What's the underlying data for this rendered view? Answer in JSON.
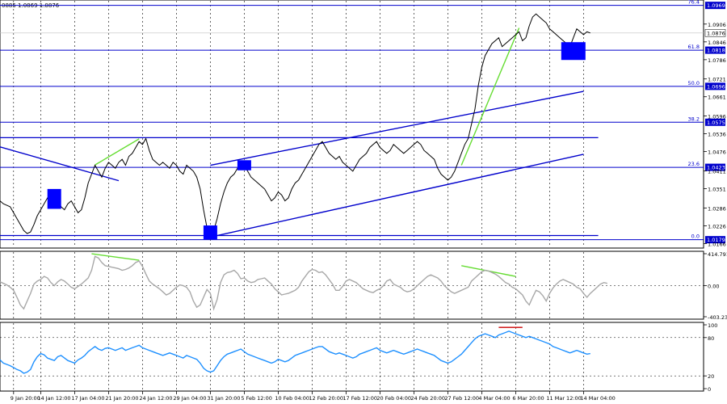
{
  "header": {
    "ohlc_text": "0885 1.0869 1.0876"
  },
  "chart_data": [
    {
      "type": "line",
      "panel": "price",
      "symbol": "EURUSD",
      "timeframe": "H4",
      "ylim": [
        1.0159,
        1.0979
      ],
      "y_axis_labels": [
        {
          "text": "1.0906",
          "y": 1.0906
        },
        {
          "text": "1.0846",
          "y": 1.0846
        },
        {
          "text": "1.0786",
          "y": 1.0786
        },
        {
          "text": "1.0721",
          "y": 1.0721
        },
        {
          "text": "1.0661",
          "y": 1.0661
        },
        {
          "text": "1.0596",
          "y": 1.0596
        },
        {
          "text": "1.0536",
          "y": 1.0536
        },
        {
          "text": "1.0476",
          "y": 1.0476
        },
        {
          "text": "1.0411",
          "y": 1.0411
        },
        {
          "text": "1.0351",
          "y": 1.0351
        },
        {
          "text": "1.0286",
          "y": 1.0286
        },
        {
          "text": "1.0226",
          "y": 1.0226
        },
        {
          "text": "1.0166",
          "y": 1.0166
        }
      ],
      "current_price": {
        "text": "1.0876",
        "y": 1.0876
      },
      "fibonacci_levels": [
        {
          "label": "76.4",
          "value_text": "1.0969",
          "y": 1.0969
        },
        {
          "label": "61.8",
          "value_text": "1.0818",
          "y": 1.0818
        },
        {
          "label": "50.0",
          "value_text": "1.0696",
          "y": 1.0696
        },
        {
          "label": "38.2",
          "value_text": "1.0575",
          "y": 1.0575
        },
        {
          "label": "23.6",
          "value_text": "1.0423",
          "y": 1.0423
        },
        {
          "label": "0.0",
          "value_text": "1.0179",
          "y": 1.0179
        }
      ],
      "horizontal_lines": [
        {
          "y": 1.0523,
          "x_from": 0,
          "x_to": 153
        },
        {
          "y": 1.0193,
          "x_from": 0,
          "x_to": 153
        }
      ],
      "trend_lines": [
        {
          "color": "#0000cc",
          "points": [
            [
              0,
              1.0492
            ],
            [
              35,
              1.0378
            ]
          ]
        },
        {
          "color": "#0000cc",
          "points": [
            [
              64,
              1.0193
            ],
            [
              172,
              1.0467
            ]
          ]
        },
        {
          "color": "#0000cc",
          "points": [
            [
              62,
              1.043
            ],
            [
              172,
              1.0679
            ]
          ]
        },
        {
          "color": "#66dd33",
          "points": [
            [
              28,
              1.0431
            ],
            [
              41,
              1.0519
            ]
          ]
        },
        {
          "color": "#66dd33",
          "points": [
            [
              136,
              1.043
            ],
            [
              153,
              1.0893
            ]
          ]
        }
      ],
      "markers": [
        {
          "x": 16,
          "y_top": 1.035,
          "y_bottom": 1.0283
        },
        {
          "x": 62,
          "y_top": 1.0227,
          "y_bottom": 1.018
        },
        {
          "x": 72,
          "y_top": 1.0447,
          "y_bottom": 1.0413
        },
        {
          "x": 169,
          "y_top": 1.0845,
          "y_bottom": 1.0785
        }
      ],
      "vertical_grid_x": [
        4,
        12,
        22,
        32,
        42,
        52,
        62,
        72,
        82,
        92,
        102,
        112,
        122,
        132,
        142,
        152,
        162,
        172
      ],
      "series": [
        {
          "values": [
            1.031,
            1.03,
            1.0295,
            1.029,
            1.027,
            1.025,
            1.023,
            1.021,
            1.02,
            1.0205,
            1.023,
            1.026,
            1.028,
            1.03,
            1.032,
            1.031,
            1.03,
            1.032,
            1.029,
            1.028,
            1.03,
            1.031,
            1.029,
            1.027,
            1.028,
            1.032,
            1.037,
            1.04,
            1.043,
            1.041,
            1.039,
            1.042,
            1.044,
            1.043,
            1.042,
            1.044,
            1.045,
            1.043,
            1.046,
            1.047,
            1.049,
            1.051,
            1.05,
            1.052,
            1.048,
            1.045,
            1.044,
            1.043,
            1.044,
            1.043,
            1.042,
            1.044,
            1.043,
            1.041,
            1.04,
            1.043,
            1.042,
            1.041,
            1.039,
            1.035,
            1.028,
            1.022,
            1.02,
            1.021,
            1.025,
            1.03,
            1.034,
            1.037,
            1.039,
            1.04,
            1.042,
            1.044,
            1.043,
            1.041,
            1.039,
            1.038,
            1.037,
            1.036,
            1.035,
            1.033,
            1.031,
            1.032,
            1.034,
            1.033,
            1.031,
            1.032,
            1.035,
            1.037,
            1.038,
            1.04,
            1.042,
            1.044,
            1.046,
            1.048,
            1.05,
            1.051,
            1.049,
            1.047,
            1.046,
            1.045,
            1.046,
            1.044,
            1.043,
            1.042,
            1.041,
            1.043,
            1.045,
            1.046,
            1.047,
            1.049,
            1.05,
            1.051,
            1.049,
            1.048,
            1.047,
            1.048,
            1.05,
            1.049,
            1.048,
            1.047,
            1.048,
            1.049,
            1.05,
            1.051,
            1.05,
            1.048,
            1.047,
            1.046,
            1.045,
            1.042,
            1.04,
            1.039,
            1.038,
            1.039,
            1.041,
            1.044,
            1.047,
            1.05,
            1.052,
            1.057,
            1.062,
            1.07,
            1.076,
            1.08,
            1.082,
            1.084,
            1.085,
            1.086,
            1.083,
            1.084,
            1.085,
            1.086,
            1.087,
            1.088,
            1.085,
            1.086,
            1.09,
            1.093,
            1.094,
            1.093,
            1.092,
            1.091,
            1.089,
            1.088,
            1.087,
            1.086,
            1.085,
            1.084,
            1.083,
            1.086,
            1.089,
            1.088,
            1.087,
            1.088,
            1.0876
          ]
        }
      ]
    },
    {
      "type": "line",
      "panel": "oscillator",
      "ylim": [
        -403.234,
        414.7912
      ],
      "y_axis_labels": [
        {
          "text": "414.7912",
          "y": 414.7912
        },
        {
          "text": "0.00",
          "y": 0
        },
        {
          "text": "-403.234",
          "y": -403.234
        }
      ],
      "trend_lines": [
        {
          "color": "#66dd33",
          "points": [
            [
              27,
              414
            ],
            [
              41,
              330
            ]
          ]
        },
        {
          "color": "#66dd33",
          "points": [
            [
              136,
              260
            ],
            [
              152,
              120
            ]
          ]
        }
      ],
      "series": [
        {
          "values": [
            50,
            30,
            10,
            -20,
            -60,
            -150,
            -250,
            -300,
            -200,
            -100,
            20,
            60,
            80,
            120,
            100,
            40,
            0,
            50,
            80,
            60,
            20,
            -20,
            -40,
            -10,
            20,
            60,
            100,
            200,
            380,
            360,
            300,
            260,
            250,
            240,
            230,
            220,
            200,
            210,
            230,
            260,
            300,
            320,
            250,
            150,
            60,
            20,
            -10,
            -40,
            -80,
            -120,
            -100,
            -60,
            -20,
            10,
            0,
            -20,
            -80,
            -200,
            -280,
            -250,
            -150,
            -50,
            -100,
            -300,
            -180,
            40,
            140,
            170,
            180,
            200,
            160,
            90,
            100,
            60,
            40,
            50,
            80,
            90,
            100,
            60,
            20,
            -40,
            -80,
            -120,
            -110,
            -100,
            -80,
            -60,
            -20,
            60,
            120,
            180,
            210,
            200,
            170,
            180,
            140,
            80,
            20,
            -60,
            -60,
            -10,
            60,
            80,
            60,
            40,
            0,
            -40,
            -60,
            -80,
            -90,
            -60,
            -40,
            0,
            60,
            80,
            20,
            0,
            -20,
            -60,
            -80,
            -70,
            -40,
            0,
            40,
            80,
            120,
            140,
            120,
            100,
            60,
            0,
            -40,
            -80,
            -100,
            -80,
            -60,
            -40,
            -20,
            60,
            100,
            140,
            180,
            200,
            190,
            170,
            150,
            120,
            80,
            40,
            20,
            -20,
            -40,
            -80,
            -120,
            -200,
            -250,
            -150,
            -60,
            -80,
            -130,
            -200,
            -100,
            -30,
            20,
            60,
            80,
            60,
            40,
            20,
            -20,
            -40,
            -100,
            -150,
            -100,
            -60,
            -20,
            20,
            40,
            30
          ]
        }
      ]
    },
    {
      "type": "line",
      "panel": "rsi",
      "ylim": [
        0,
        100
      ],
      "y_axis_labels": [
        {
          "text": "100",
          "y": 100
        },
        {
          "text": "80",
          "y": 80
        },
        {
          "text": "20",
          "y": 20
        },
        {
          "text": "0",
          "y": 0
        }
      ],
      "trend_lines": [
        {
          "color": "#cc0000",
          "points": [
            [
              147,
              96
            ],
            [
              154,
              96
            ]
          ]
        }
      ],
      "series": [
        {
          "values": [
            45,
            40,
            38,
            36,
            33,
            30,
            28,
            24,
            26,
            30,
            42,
            50,
            55,
            53,
            48,
            46,
            44,
            50,
            52,
            48,
            44,
            42,
            40,
            45,
            48,
            52,
            58,
            62,
            66,
            62,
            60,
            63,
            64,
            62,
            60,
            62,
            64,
            60,
            62,
            64,
            66,
            68,
            64,
            62,
            60,
            58,
            56,
            54,
            52,
            54,
            56,
            54,
            52,
            50,
            48,
            52,
            50,
            48,
            46,
            40,
            32,
            28,
            26,
            28,
            36,
            44,
            50,
            54,
            56,
            58,
            60,
            62,
            58,
            54,
            52,
            50,
            48,
            46,
            44,
            42,
            40,
            42,
            46,
            44,
            42,
            44,
            48,
            52,
            54,
            56,
            58,
            60,
            62,
            64,
            66,
            66,
            62,
            58,
            56,
            54,
            56,
            54,
            52,
            50,
            48,
            50,
            54,
            56,
            58,
            60,
            62,
            64,
            60,
            58,
            56,
            58,
            60,
            58,
            56,
            54,
            56,
            58,
            60,
            62,
            60,
            58,
            56,
            54,
            52,
            48,
            44,
            42,
            40,
            42,
            46,
            50,
            54,
            60,
            66,
            72,
            78,
            82,
            84,
            86,
            84,
            82,
            80,
            84,
            86,
            88,
            90,
            88,
            86,
            84,
            82,
            80,
            82,
            80,
            78,
            76,
            74,
            72,
            70,
            66,
            64,
            62,
            60,
            58,
            56,
            58,
            60,
            58,
            56,
            54,
            55
          ]
        }
      ]
    }
  ],
  "x_axis": {
    "labels": [
      "9 Jan 20:00",
      "14 Jan 12:00",
      "17 Jan 04:00",
      "21 Jan 20:00",
      "24 Jan 12:00",
      "29 Jan 04:00",
      "31 Jan 20:00",
      "5 Feb 12:00",
      "10 Feb 04:00",
      "12 Feb 20:00",
      "17 Feb 12:00",
      "20 Feb 04:00",
      "24 Feb 20:00",
      "27 Feb 12:00",
      "4 Mar 04:00",
      "6 Mar 20:00",
      "11 Mar 12:00",
      "14 Mar 04:00"
    ],
    "positions": [
      4,
      12,
      22,
      32,
      42,
      52,
      62,
      72,
      82,
      92,
      102,
      112,
      122,
      132,
      142,
      152,
      162,
      172
    ]
  },
  "colors": {
    "price": "#000000",
    "level": "#0000cc",
    "marker": "#0000ff",
    "oscillator": "#a8a8a8",
    "rsi": "#1e90ff",
    "grid": "#000000",
    "divergence_green": "#66dd33",
    "divergence_red": "#cc0000"
  }
}
